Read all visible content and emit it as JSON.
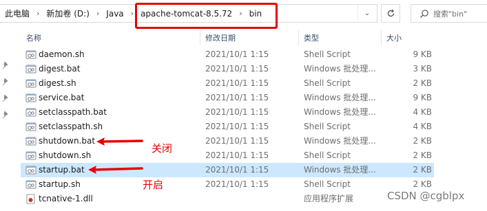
{
  "address_bar": {
    "crumbs": [
      "此电脑",
      "新加卷 (D:)",
      "Java",
      "apache-tomcat-8.5.72",
      "bin"
    ]
  },
  "search": {
    "placeholder": "搜索\"bin\""
  },
  "columns": {
    "name": "名称",
    "date": "修改日期",
    "type": "类型",
    "size": "大小"
  },
  "files": [
    {
      "name": "daemon.sh",
      "date": "2021/10/1 1:15",
      "type": "Shell Script",
      "size": "9 KB"
    },
    {
      "name": "digest.bat",
      "date": "2021/10/1 1:15",
      "type": "Windows 批处理...",
      "size": "3 KB"
    },
    {
      "name": "digest.sh",
      "date": "2021/10/1 1:15",
      "type": "Shell Script",
      "size": "2 KB"
    },
    {
      "name": "service.bat",
      "date": "2021/10/1 1:15",
      "type": "Windows 批处理...",
      "size": "9 KB"
    },
    {
      "name": "setclasspath.bat",
      "date": "2021/10/1 1:15",
      "type": "Windows 批处理...",
      "size": "4 KB"
    },
    {
      "name": "setclasspath.sh",
      "date": "2021/10/1 1:15",
      "type": "Shell Script",
      "size": "4 KB"
    },
    {
      "name": "shutdown.bat",
      "date": "2021/10/1 1:15",
      "type": "Windows 批处理...",
      "size": "2 KB"
    },
    {
      "name": "shutdown.sh",
      "date": "2021/10/1 1:15",
      "type": "Shell Script",
      "size": "2 KB"
    },
    {
      "name": "startup.bat",
      "date": "2021/10/1 1:15",
      "type": "Windows 批处理...",
      "size": "2 KB",
      "selected": true
    },
    {
      "name": "startup.sh",
      "date": "2021/10/1 1:15",
      "type": "Shell Script",
      "size": "2 KB"
    },
    {
      "name": "tcnative-1.dll",
      "date": "",
      "type": "应用程序扩展",
      "size": ""
    }
  ],
  "annotations": {
    "close_label": "关闭",
    "open_label": "开启"
  },
  "watermark": "CSDN @cgblpx",
  "colors": {
    "highlight_box": "#e60000",
    "selected_row": "#cce8ff",
    "annotation": "#e60000"
  }
}
